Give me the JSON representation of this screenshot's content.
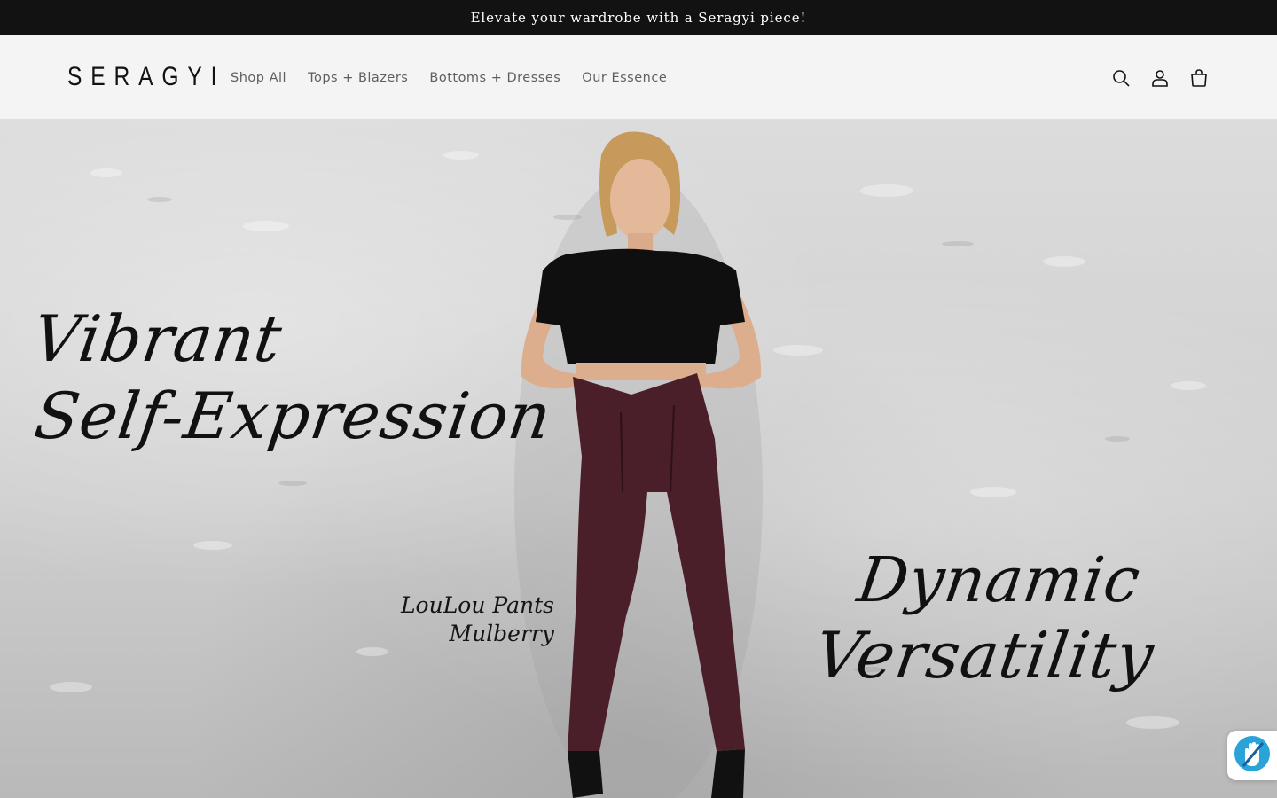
{
  "announcement": {
    "text": "Elevate your wardrobe with a Seragyi piece!"
  },
  "header": {
    "logo": "SERAGYI",
    "nav": [
      {
        "label": "Shop All"
      },
      {
        "label": "Tops + Blazers"
      },
      {
        "label": "Bottoms + Dresses"
      },
      {
        "label": "Our Essence"
      }
    ],
    "icons": [
      "search-icon",
      "account-icon",
      "cart-icon"
    ]
  },
  "hero": {
    "tagline_left": [
      "Vibrant",
      "Self-Expression"
    ],
    "tagline_right": [
      "Dynamic",
      "Versatility"
    ],
    "product": {
      "name": "LouLou Pants",
      "color": "Mulberry"
    }
  },
  "badge": {
    "icon": "privacy-hand-icon"
  },
  "colors": {
    "announcement_bg": "#121212",
    "header_bg": "#f4f4f4",
    "nav_text": "#5e5e5e",
    "pants": "#4b1f29",
    "top": "#0f0f0f"
  }
}
